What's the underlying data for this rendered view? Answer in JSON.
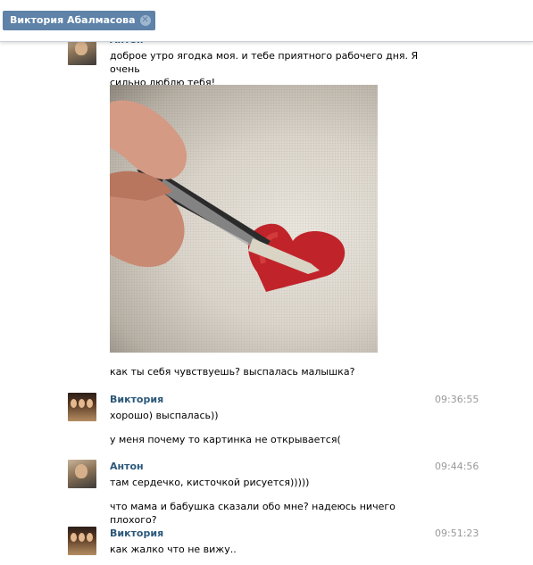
{
  "tab": {
    "title": "Виктория Абалмасова",
    "close_icon": "close-icon"
  },
  "messages": [
    {
      "author": "Антон",
      "avatar": "anton",
      "time": "",
      "lines": [
        "доброе утро ягодка моя. и тебе приятного рабочего дня. Я очень",
        "сильно люблю тебя!"
      ],
      "attachment": "photo-heart-painting"
    },
    {
      "author": "",
      "time": "",
      "lines": [
        "как ты себя чувствуешь? выспалась малышка?"
      ]
    },
    {
      "author": "Виктория",
      "avatar": "viktoria",
      "time": "09:36:55",
      "lines": [
        "хорошо) выспалась))"
      ]
    },
    {
      "author": "",
      "time": "",
      "lines": [
        "у меня почему то картинка не открывается("
      ]
    },
    {
      "author": "Антон",
      "avatar": "anton",
      "time": "09:44:56",
      "lines": [
        "там сердечко, кисточкой рисуется)))))"
      ]
    },
    {
      "author": "",
      "time": "",
      "lines": [
        "что мама и бабушка сказали обо мне? надеюсь ничего плохого?"
      ]
    },
    {
      "author": "Виктория",
      "avatar": "viktoria",
      "time": "09:51:23",
      "lines": [
        "как жалко что не вижу.."
      ]
    }
  ],
  "colors": {
    "tab_bg": "#5e82a8",
    "author": "#2b587a",
    "time": "#999999"
  }
}
